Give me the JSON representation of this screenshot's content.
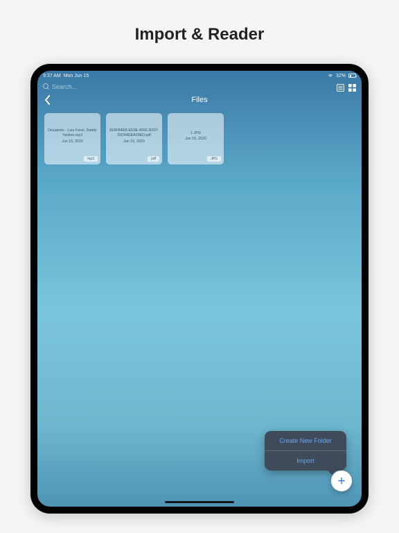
{
  "marketing_title": "Import & Reader",
  "status": {
    "time": "9:37 AM",
    "date": "Mon Jun 15",
    "battery": "32%"
  },
  "search_placeholder": "Search...",
  "nav_title": "Files",
  "files": [
    {
      "name": "Despacito - Luis Fonsi, Daddy Yankee.mp3",
      "date": "Jun 15, 2020",
      "ext": "mp3"
    },
    {
      "name": "2E9FB4EB-EE0E-459C-B207-20D44DEA29ED.pdf",
      "date": "Jun 15, 2020",
      "ext": "pdf"
    },
    {
      "name": "1.JPG",
      "date": "Jun 15, 2020",
      "ext": "JPG"
    }
  ],
  "popover": {
    "create_folder": "Create New Folder",
    "import": "Import"
  }
}
